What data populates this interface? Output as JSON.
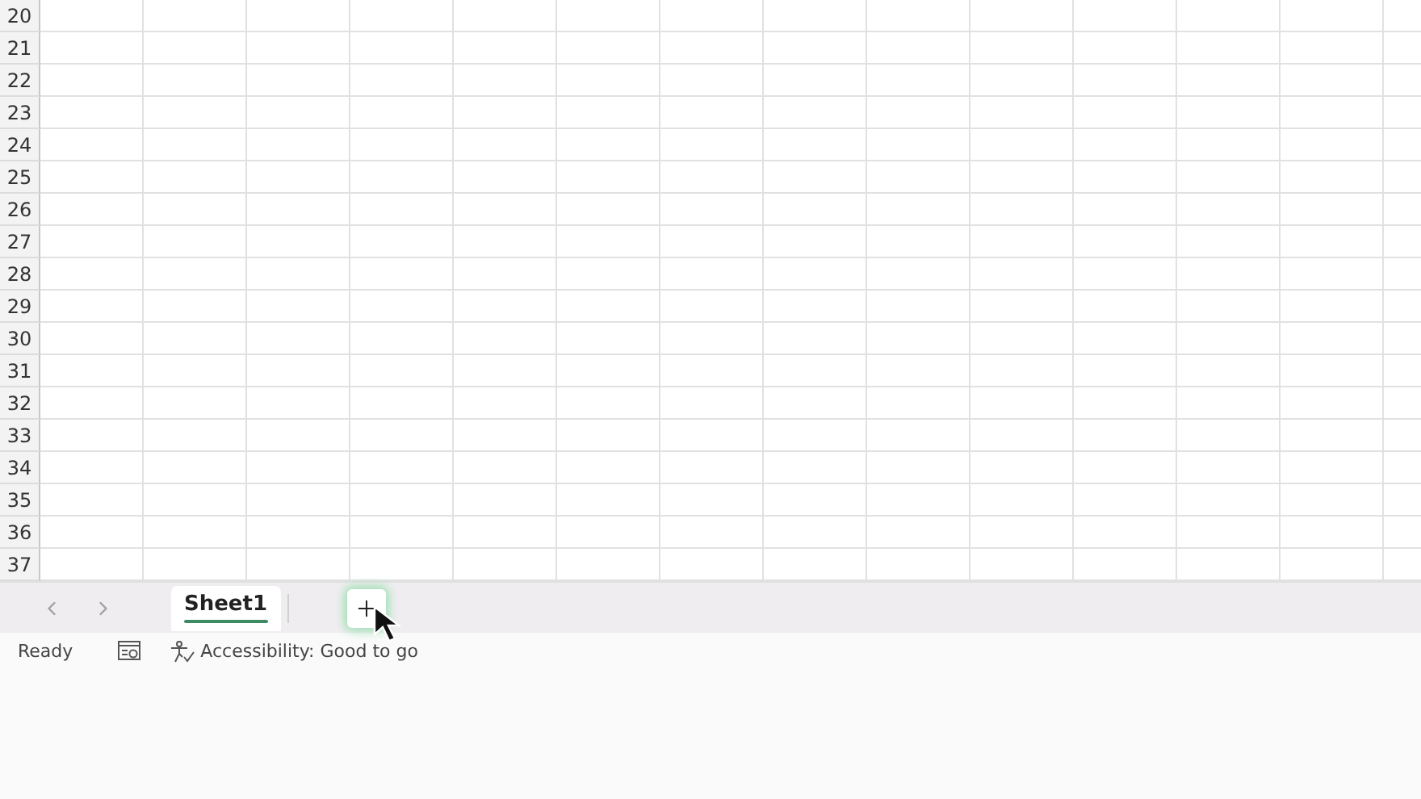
{
  "grid": {
    "row_numbers": [
      "20",
      "21",
      "22",
      "23",
      "24",
      "25",
      "26",
      "27",
      "28",
      "29",
      "30",
      "31",
      "32",
      "33",
      "34",
      "35",
      "36",
      "37"
    ]
  },
  "sheet_tabs": [
    {
      "label": "Sheet1",
      "selected": true
    }
  ],
  "status_bar": {
    "status": "Ready",
    "accessibility": "Accessibility: Good to go"
  }
}
